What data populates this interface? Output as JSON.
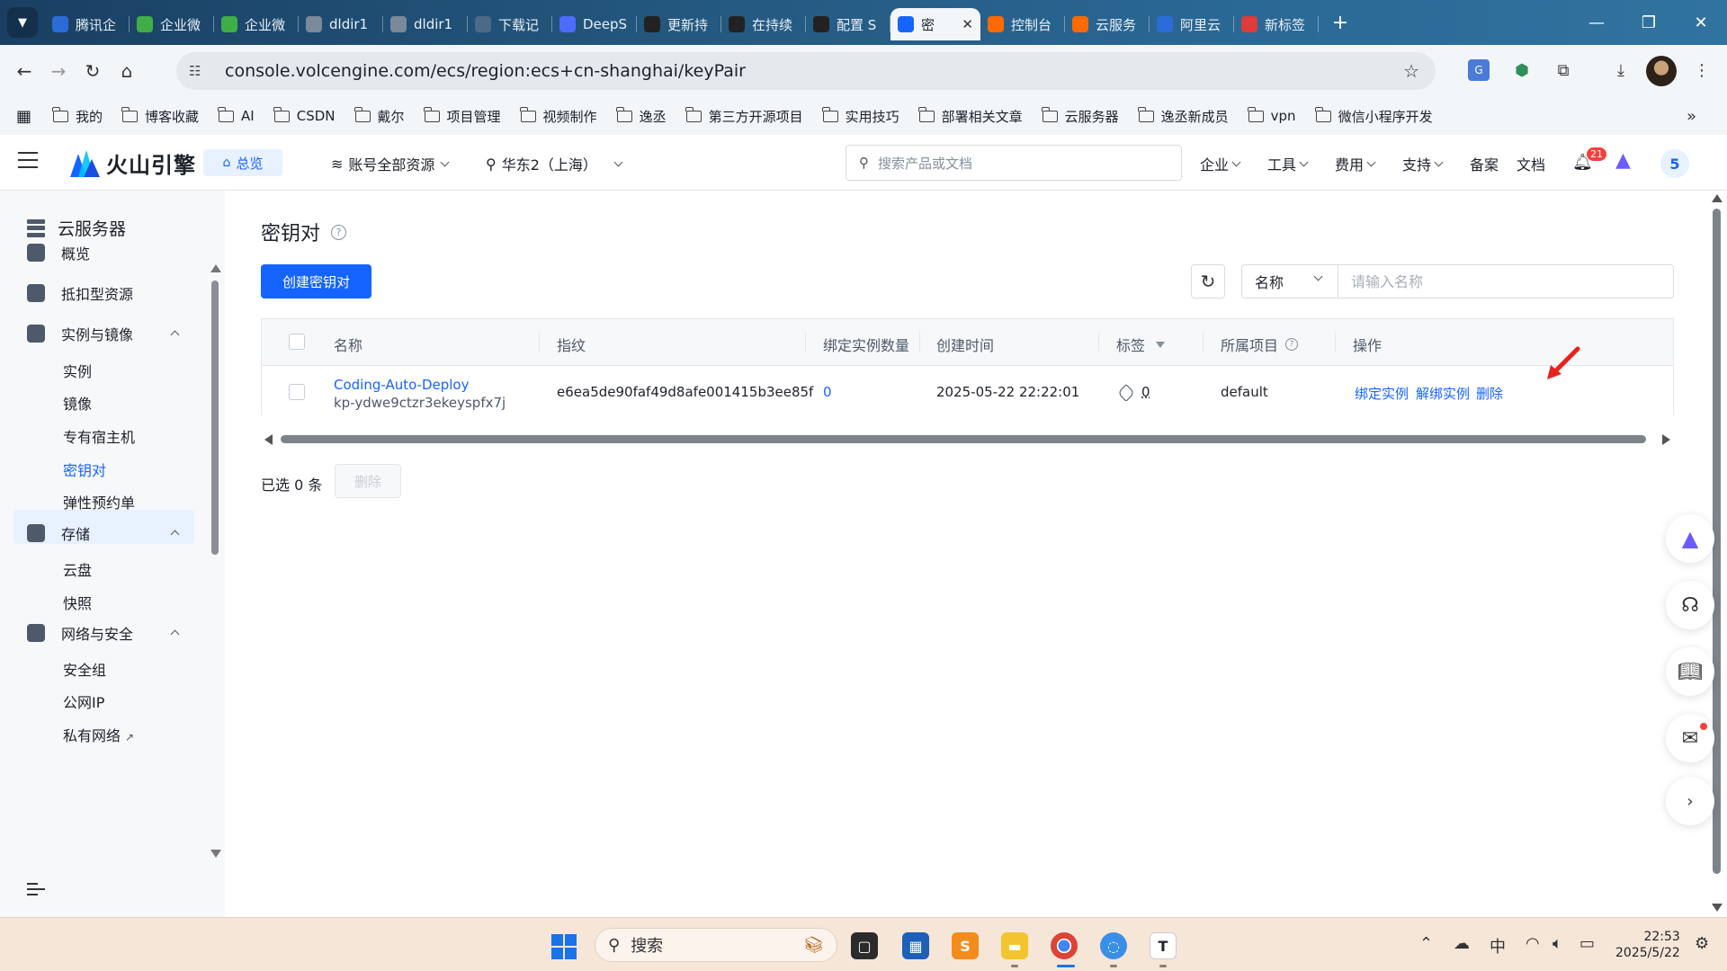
{
  "browser": {
    "tabs": [
      {
        "label": "腾讯企",
        "color": "#2b6cd8"
      },
      {
        "label": "企业微",
        "color": "#3fae49"
      },
      {
        "label": "企业微",
        "color": "#3fae49"
      },
      {
        "label": "dldir1",
        "color": "#7a8a99"
      },
      {
        "label": "dldir1",
        "color": "#7a8a99"
      },
      {
        "label": "下载记",
        "color": "#4a6a88"
      },
      {
        "label": "DeepS",
        "color": "#4d6bfe"
      },
      {
        "label": "更新持",
        "color": "#222222"
      },
      {
        "label": "在持续",
        "color": "#222222"
      },
      {
        "label": "配置 S",
        "color": "#222222"
      },
      {
        "label": "密",
        "color": "#1664ff",
        "active": true
      },
      {
        "label": "控制台",
        "color": "#ff6a00"
      },
      {
        "label": "云服务",
        "color": "#ff6a00"
      },
      {
        "label": "阿里云",
        "color": "#2b6cd8"
      },
      {
        "label": "新标签",
        "color": "#e03a3a"
      }
    ],
    "url": "console.volcengine.com/ecs/region:ecs+cn-shanghai/keyPair",
    "bookmarks": [
      "我的",
      "博客收藏",
      "AI",
      "CSDN",
      "戴尔",
      "项目管理",
      "视频制作",
      "逸丞",
      "第三方开源项目",
      "实用技巧",
      "部署相关文章",
      "云服务器",
      "逸丞新成员",
      "vpn",
      "微信小程序开发"
    ]
  },
  "header": {
    "logo_text": "火山引擎",
    "overview": "总览",
    "account_scope": "账号全部资源",
    "region": "华东2（上海）",
    "search_placeholder": "搜索产品或文档",
    "menu": [
      "企业",
      "工具",
      "费用",
      "支持"
    ],
    "links": [
      "备案",
      "文档"
    ],
    "notification_count": "21",
    "avatar": "5"
  },
  "sidebar": {
    "title": "云服务器",
    "items": [
      {
        "label": "概览",
        "type": "item"
      },
      {
        "label": "抵扣型资源",
        "type": "item"
      },
      {
        "label": "实例与镜像",
        "type": "group"
      },
      {
        "label": "实例",
        "type": "sub"
      },
      {
        "label": "镜像",
        "type": "sub"
      },
      {
        "label": "专有宿主机",
        "type": "sub"
      },
      {
        "label": "密钥对",
        "type": "sub",
        "active": true
      },
      {
        "label": "弹性预约单",
        "type": "sub"
      },
      {
        "label": "存储",
        "type": "group"
      },
      {
        "label": "云盘",
        "type": "sub"
      },
      {
        "label": "快照",
        "type": "sub"
      },
      {
        "label": "网络与安全",
        "type": "group"
      },
      {
        "label": "安全组",
        "type": "sub"
      },
      {
        "label": "公网IP",
        "type": "sub"
      },
      {
        "label": "私有网络",
        "type": "sub"
      }
    ]
  },
  "main": {
    "title": "密钥对",
    "create_button": "创建密钥对",
    "filter_field": "名称",
    "filter_placeholder": "请输入名称",
    "columns": [
      "名称",
      "指纹",
      "绑定实例数量",
      "创建时间",
      "标签",
      "所属项目",
      "操作"
    ],
    "rows": [
      {
        "name": "Coding-Auto-Deploy",
        "id": "kp-ydwe9ctzr3ekeyspfx7j",
        "fingerprint": "e6ea5de90faf49d8afe001415b3ee85f",
        "instance_count": "0",
        "created": "2025-05-22 22:22:01",
        "tags": "0",
        "project": "default",
        "actions": [
          "绑定实例",
          "解绑实例",
          "删除"
        ]
      }
    ],
    "selected_text": "已选 0 条",
    "delete_button": "删除"
  },
  "taskbar": {
    "search": "搜索",
    "ime": "中",
    "time": "22:53",
    "date": "2025/5/22"
  },
  "colors": {
    "primary": "#1664ff",
    "annotation_arrow": "#e8231f"
  }
}
